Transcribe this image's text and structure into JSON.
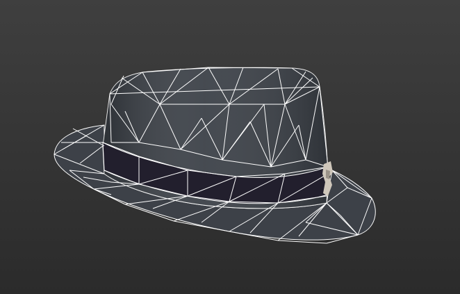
{
  "scene": {
    "background_top": "#3f3f3f",
    "background_bottom": "#2b2b2b",
    "wire_color": "#ffffff",
    "body_color": "#3a3f46",
    "band_color": "#221f2d",
    "brim_color": "#3d4148",
    "ornament_color": "#cfc7bb"
  }
}
